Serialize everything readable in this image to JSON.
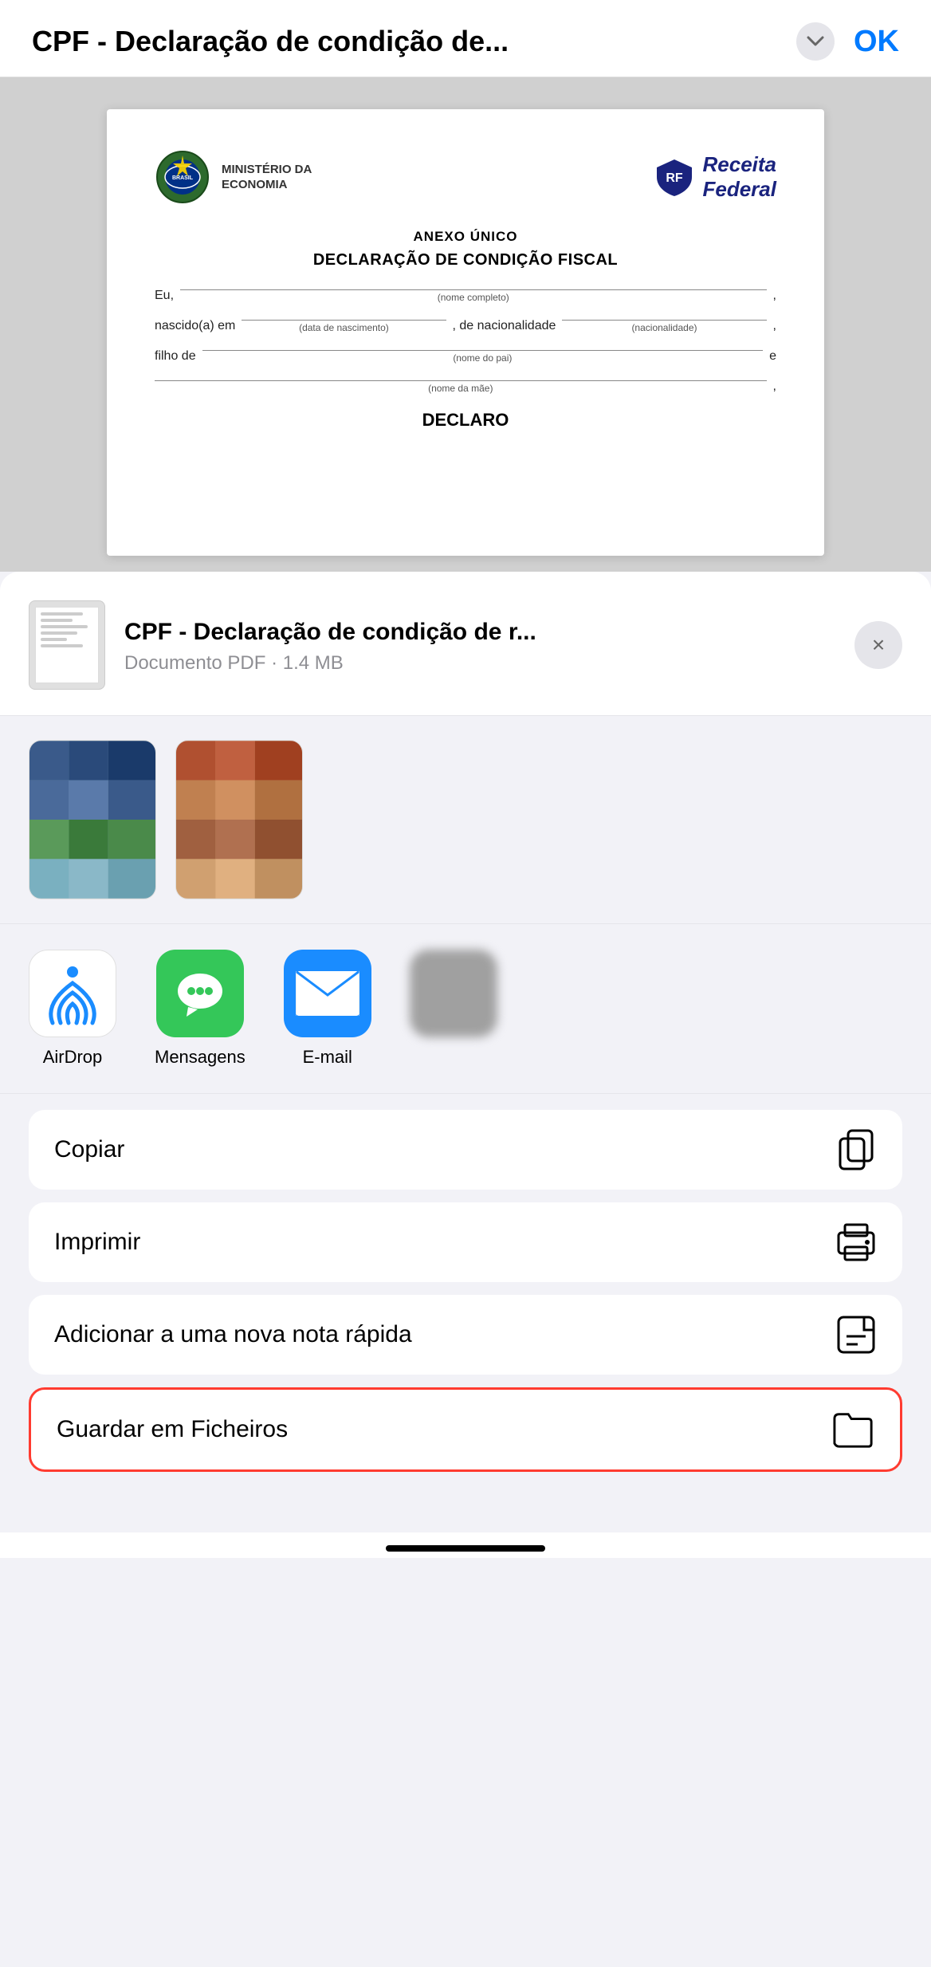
{
  "nav": {
    "title": "CPF - Declaração de condição de...",
    "ok_label": "OK"
  },
  "pdf": {
    "ministry": "MINISTÉRIO DA\nECONOMIA",
    "rf_label": "Receita Federal",
    "anexo": "ANEXO ÚNICO",
    "main_title": "DECLARAÇÃO DE CONDIÇÃO FISCAL",
    "field1_prefix": "Eu,",
    "field1_label": "(nome completo)",
    "field2_prefix": "nascido(a) em",
    "field2_mid": ", de nacionalidade",
    "field2_label1": "(data de nascimento)",
    "field2_label2": "(nacionalidade)",
    "field3_prefix": "filho de",
    "field3_label": "(nome do pai)",
    "field4_label": "(nome da mãe)",
    "declare_label": "DECLARO"
  },
  "share": {
    "filename": "CPF - Declaração de condição de r...",
    "meta": "Documento PDF · 1.4 MB",
    "close_label": "×"
  },
  "apps": [
    {
      "id": "airdrop",
      "label": "AirDrop",
      "type": "airdrop"
    },
    {
      "id": "mensagens",
      "label": "Mensagens",
      "type": "messages"
    },
    {
      "id": "email",
      "label": "E-mail",
      "type": "mail"
    },
    {
      "id": "blurred1",
      "label": "",
      "type": "blurred"
    }
  ],
  "actions": [
    {
      "id": "copy",
      "label": "Copiar",
      "icon": "copy"
    },
    {
      "id": "print",
      "label": "Imprimir",
      "icon": "print"
    },
    {
      "id": "note",
      "label": "Adicionar a uma nova nota rápida",
      "icon": "note"
    },
    {
      "id": "save-files",
      "label": "Guardar em Ficheiros",
      "icon": "folder",
      "highlighted": true
    }
  ]
}
